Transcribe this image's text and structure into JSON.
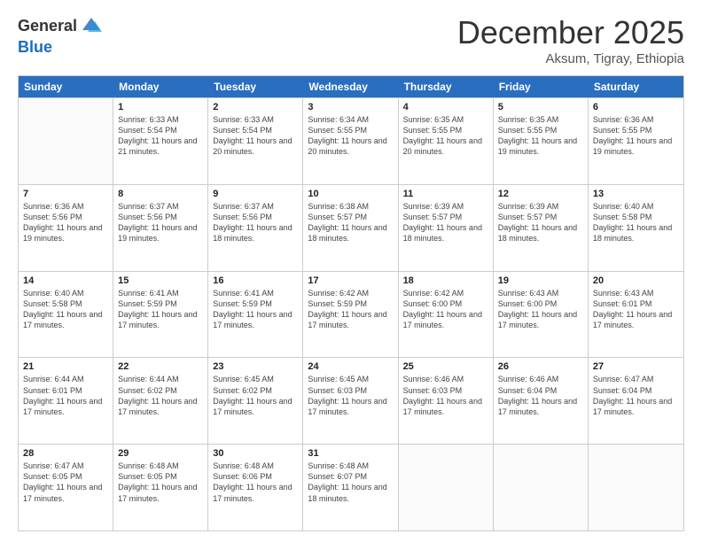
{
  "header": {
    "logo_line1": "General",
    "logo_line2": "Blue",
    "month_title": "December 2025",
    "subtitle": "Aksum, Tigray, Ethiopia"
  },
  "weekdays": [
    "Sunday",
    "Monday",
    "Tuesday",
    "Wednesday",
    "Thursday",
    "Friday",
    "Saturday"
  ],
  "weeks": [
    [
      {
        "day": "",
        "sunrise": "",
        "sunset": "",
        "daylight": ""
      },
      {
        "day": "1",
        "sunrise": "Sunrise: 6:33 AM",
        "sunset": "Sunset: 5:54 PM",
        "daylight": "Daylight: 11 hours and 21 minutes."
      },
      {
        "day": "2",
        "sunrise": "Sunrise: 6:33 AM",
        "sunset": "Sunset: 5:54 PM",
        "daylight": "Daylight: 11 hours and 20 minutes."
      },
      {
        "day": "3",
        "sunrise": "Sunrise: 6:34 AM",
        "sunset": "Sunset: 5:55 PM",
        "daylight": "Daylight: 11 hours and 20 minutes."
      },
      {
        "day": "4",
        "sunrise": "Sunrise: 6:35 AM",
        "sunset": "Sunset: 5:55 PM",
        "daylight": "Daylight: 11 hours and 20 minutes."
      },
      {
        "day": "5",
        "sunrise": "Sunrise: 6:35 AM",
        "sunset": "Sunset: 5:55 PM",
        "daylight": "Daylight: 11 hours and 19 minutes."
      },
      {
        "day": "6",
        "sunrise": "Sunrise: 6:36 AM",
        "sunset": "Sunset: 5:55 PM",
        "daylight": "Daylight: 11 hours and 19 minutes."
      }
    ],
    [
      {
        "day": "7",
        "sunrise": "Sunrise: 6:36 AM",
        "sunset": "Sunset: 5:56 PM",
        "daylight": "Daylight: 11 hours and 19 minutes."
      },
      {
        "day": "8",
        "sunrise": "Sunrise: 6:37 AM",
        "sunset": "Sunset: 5:56 PM",
        "daylight": "Daylight: 11 hours and 19 minutes."
      },
      {
        "day": "9",
        "sunrise": "Sunrise: 6:37 AM",
        "sunset": "Sunset: 5:56 PM",
        "daylight": "Daylight: 11 hours and 18 minutes."
      },
      {
        "day": "10",
        "sunrise": "Sunrise: 6:38 AM",
        "sunset": "Sunset: 5:57 PM",
        "daylight": "Daylight: 11 hours and 18 minutes."
      },
      {
        "day": "11",
        "sunrise": "Sunrise: 6:39 AM",
        "sunset": "Sunset: 5:57 PM",
        "daylight": "Daylight: 11 hours and 18 minutes."
      },
      {
        "day": "12",
        "sunrise": "Sunrise: 6:39 AM",
        "sunset": "Sunset: 5:57 PM",
        "daylight": "Daylight: 11 hours and 18 minutes."
      },
      {
        "day": "13",
        "sunrise": "Sunrise: 6:40 AM",
        "sunset": "Sunset: 5:58 PM",
        "daylight": "Daylight: 11 hours and 18 minutes."
      }
    ],
    [
      {
        "day": "14",
        "sunrise": "Sunrise: 6:40 AM",
        "sunset": "Sunset: 5:58 PM",
        "daylight": "Daylight: 11 hours and 17 minutes."
      },
      {
        "day": "15",
        "sunrise": "Sunrise: 6:41 AM",
        "sunset": "Sunset: 5:59 PM",
        "daylight": "Daylight: 11 hours and 17 minutes."
      },
      {
        "day": "16",
        "sunrise": "Sunrise: 6:41 AM",
        "sunset": "Sunset: 5:59 PM",
        "daylight": "Daylight: 11 hours and 17 minutes."
      },
      {
        "day": "17",
        "sunrise": "Sunrise: 6:42 AM",
        "sunset": "Sunset: 5:59 PM",
        "daylight": "Daylight: 11 hours and 17 minutes."
      },
      {
        "day": "18",
        "sunrise": "Sunrise: 6:42 AM",
        "sunset": "Sunset: 6:00 PM",
        "daylight": "Daylight: 11 hours and 17 minutes."
      },
      {
        "day": "19",
        "sunrise": "Sunrise: 6:43 AM",
        "sunset": "Sunset: 6:00 PM",
        "daylight": "Daylight: 11 hours and 17 minutes."
      },
      {
        "day": "20",
        "sunrise": "Sunrise: 6:43 AM",
        "sunset": "Sunset: 6:01 PM",
        "daylight": "Daylight: 11 hours and 17 minutes."
      }
    ],
    [
      {
        "day": "21",
        "sunrise": "Sunrise: 6:44 AM",
        "sunset": "Sunset: 6:01 PM",
        "daylight": "Daylight: 11 hours and 17 minutes."
      },
      {
        "day": "22",
        "sunrise": "Sunrise: 6:44 AM",
        "sunset": "Sunset: 6:02 PM",
        "daylight": "Daylight: 11 hours and 17 minutes."
      },
      {
        "day": "23",
        "sunrise": "Sunrise: 6:45 AM",
        "sunset": "Sunset: 6:02 PM",
        "daylight": "Daylight: 11 hours and 17 minutes."
      },
      {
        "day": "24",
        "sunrise": "Sunrise: 6:45 AM",
        "sunset": "Sunset: 6:03 PM",
        "daylight": "Daylight: 11 hours and 17 minutes."
      },
      {
        "day": "25",
        "sunrise": "Sunrise: 6:46 AM",
        "sunset": "Sunset: 6:03 PM",
        "daylight": "Daylight: 11 hours and 17 minutes."
      },
      {
        "day": "26",
        "sunrise": "Sunrise: 6:46 AM",
        "sunset": "Sunset: 6:04 PM",
        "daylight": "Daylight: 11 hours and 17 minutes."
      },
      {
        "day": "27",
        "sunrise": "Sunrise: 6:47 AM",
        "sunset": "Sunset: 6:04 PM",
        "daylight": "Daylight: 11 hours and 17 minutes."
      }
    ],
    [
      {
        "day": "28",
        "sunrise": "Sunrise: 6:47 AM",
        "sunset": "Sunset: 6:05 PM",
        "daylight": "Daylight: 11 hours and 17 minutes."
      },
      {
        "day": "29",
        "sunrise": "Sunrise: 6:48 AM",
        "sunset": "Sunset: 6:05 PM",
        "daylight": "Daylight: 11 hours and 17 minutes."
      },
      {
        "day": "30",
        "sunrise": "Sunrise: 6:48 AM",
        "sunset": "Sunset: 6:06 PM",
        "daylight": "Daylight: 11 hours and 17 minutes."
      },
      {
        "day": "31",
        "sunrise": "Sunrise: 6:48 AM",
        "sunset": "Sunset: 6:07 PM",
        "daylight": "Daylight: 11 hours and 18 minutes."
      },
      {
        "day": "",
        "sunrise": "",
        "sunset": "",
        "daylight": ""
      },
      {
        "day": "",
        "sunrise": "",
        "sunset": "",
        "daylight": ""
      },
      {
        "day": "",
        "sunrise": "",
        "sunset": "",
        "daylight": ""
      }
    ]
  ]
}
